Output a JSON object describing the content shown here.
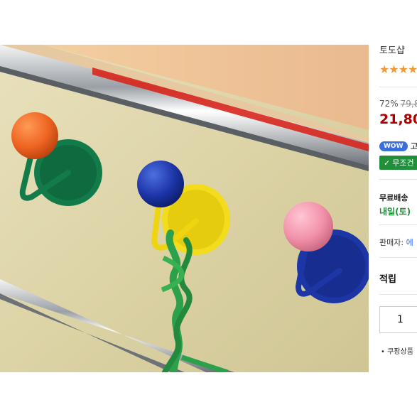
{
  "product": {
    "image_alt": "Colorful ball wall hooks",
    "title": "토도샵 ",
    "rating_stars": 4,
    "discount": "72%",
    "original_price": "79,8",
    "sale_price": "21,80",
    "wow_badge": "WOW",
    "wow_text": "고",
    "free_return": "무조건",
    "shipping_label": "무료배송",
    "shipping_date": "내일(토)",
    "seller_label": "판매자:",
    "seller_name": "에",
    "reward_label": "적립",
    "quantity": "1",
    "bullet_text": "쿠팡상품"
  },
  "colors": {
    "price_red": "#ae0000",
    "star_orange": "#f39a38",
    "wow_blue": "#3a6fd8",
    "free_green": "#1f8f3a",
    "link_blue": "#346aff"
  },
  "icons": {
    "star": "star-icon",
    "check": "check-icon",
    "bullet": "bullet-icon"
  }
}
